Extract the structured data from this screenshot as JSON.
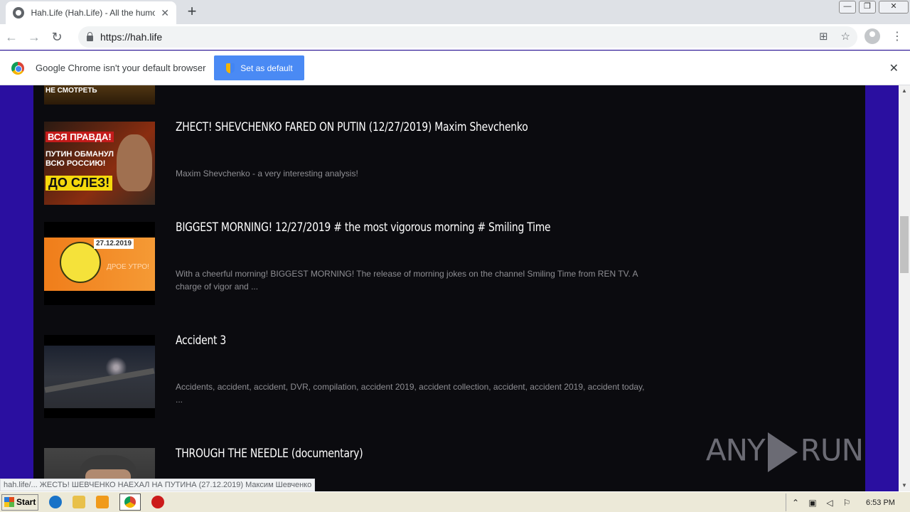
{
  "tab": {
    "title": "Hah.Life (Hah.Life) - All the humor in",
    "close": "✕"
  },
  "newtab": "+",
  "window": {
    "minimize": "—",
    "restore": "❐",
    "close": "✕"
  },
  "toolbar": {
    "back": "←",
    "forward": "→",
    "reload": "↻",
    "url": "https://hah.life",
    "translate_icon": "⊞",
    "star_icon": "☆",
    "menu_icon": "⋮"
  },
  "infobar": {
    "message": "Google Chrome isn't your default browser",
    "button": "Set as default",
    "close": "✕"
  },
  "videos": [
    {
      "title": "",
      "desc": "",
      "thumb_caption": "НЕ СМОТРЕТЬ"
    },
    {
      "title": "ZHECT! SHEVCHENKO FARED ON PUTIN (12/27/2019) Maxim Shevchenko",
      "desc": "Maxim Shevchenko - a very interesting analysis!",
      "thumb": {
        "line1": "ВСЯ ПРАВДА!",
        "line2": "ПУТИН ОБМАНУЛ",
        "line3": "ВСЮ РОССИЮ!",
        "line4": "ДО СЛЕЗ!"
      }
    },
    {
      "title": "BIGGEST MORNING! 12/27/2019 # the most vigorous morning # Smiling Time",
      "desc": "With a cheerful morning! BIGGEST MORNING! The release of morning jokes on the channel Smiling Time from REN TV. A charge of vigor and ...",
      "thumb": {
        "date": "27.12.2019",
        "sub": "ДРОЕ УТРО!"
      }
    },
    {
      "title": "Accident 3",
      "desc": "Accidents, accident, accident, DVR, compilation, accident 2019, accident collection, accident, accident 2019, accident today, ..."
    },
    {
      "title": "THROUGH THE NEEDLE (documentary)",
      "desc": ""
    }
  ],
  "watermark": {
    "left": "ANY",
    "right": "RUN"
  },
  "status_url": "hah.life/... ЖЕСТЬ! ШЕВЧЕНКО НАЕХАЛ НА ПУТИНА (27.12.2019) Максим Шевченко",
  "taskbar": {
    "start": "Start",
    "clock": "6:53 PM"
  },
  "scroll": {
    "up": "▲",
    "down": "▼"
  }
}
